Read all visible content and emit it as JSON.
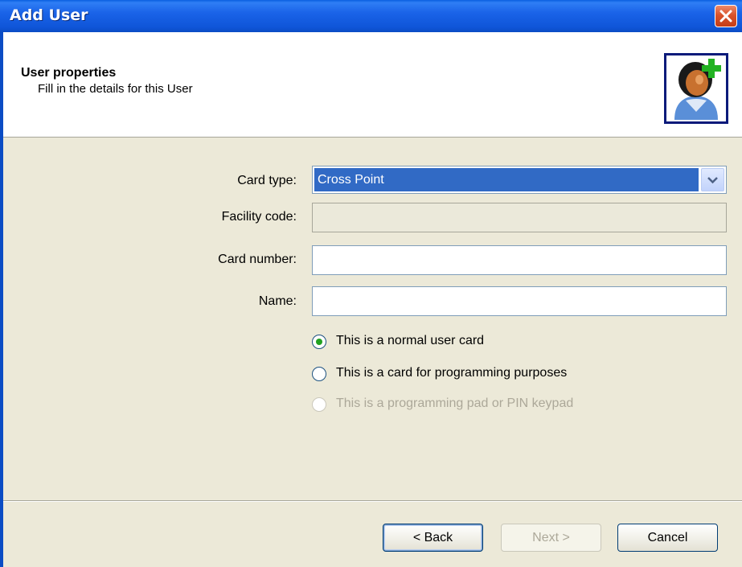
{
  "window": {
    "title": "Add User",
    "close_icon": "close-icon"
  },
  "header": {
    "title": "User properties",
    "subtitle": "Fill in the details for this User",
    "icon": "add-user-icon"
  },
  "form": {
    "card_type_label": "Card type:",
    "card_type_value": "Cross Point",
    "facility_code_label": "Facility code:",
    "facility_code_value": "",
    "card_number_label": "Card number:",
    "card_number_value": "",
    "name_label": "Name:",
    "name_value": ""
  },
  "card_role": {
    "options": [
      {
        "label": "This is a normal user card",
        "checked": true,
        "enabled": true
      },
      {
        "label": "This is a card for programming purposes",
        "checked": false,
        "enabled": true
      },
      {
        "label": "This is a programming pad or PIN keypad",
        "checked": false,
        "enabled": false
      }
    ]
  },
  "buttons": {
    "back": "< Back",
    "next": "Next >",
    "cancel": "Cancel"
  },
  "colors": {
    "titlebar": "#0b4cc4",
    "selection": "#316ac5",
    "radio_dot": "#21a121",
    "dialog_bg": "#ece9d8"
  }
}
